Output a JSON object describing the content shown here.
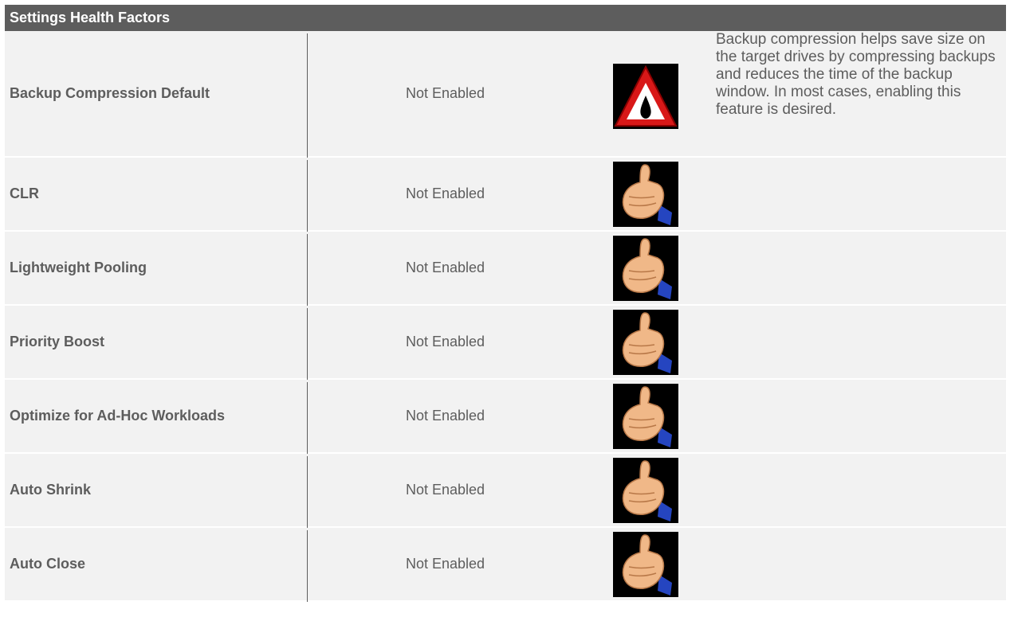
{
  "header": {
    "title": "Settings Health Factors"
  },
  "rows": [
    {
      "name": "Backup Compression Default",
      "value": "Not Enabled",
      "icon": "warning-triangle-icon",
      "description": "Backup compression helps save size on the target drives by compressing backups and reduces the time of the backup window. In most cases, enabling this feature is desired."
    },
    {
      "name": "CLR",
      "value": "Not Enabled",
      "icon": "thumbs-up-icon",
      "description": ""
    },
    {
      "name": "Lightweight Pooling",
      "value": "Not Enabled",
      "icon": "thumbs-up-icon",
      "description": ""
    },
    {
      "name": "Priority Boost",
      "value": "Not Enabled",
      "icon": "thumbs-up-icon",
      "description": ""
    },
    {
      "name": "Optimize for Ad-Hoc Workloads",
      "value": "Not Enabled",
      "icon": "thumbs-up-icon",
      "description": ""
    },
    {
      "name": "Auto Shrink",
      "value": "Not Enabled",
      "icon": "thumbs-up-icon",
      "description": ""
    },
    {
      "name": "Auto Close",
      "value": "Not Enabled",
      "icon": "thumbs-up-icon",
      "description": ""
    }
  ],
  "colors": {
    "header_bg": "#5d5d5d",
    "row_bg": "#f2f2f2",
    "text": "#5d5d5d",
    "warning_red": "#d81818"
  }
}
